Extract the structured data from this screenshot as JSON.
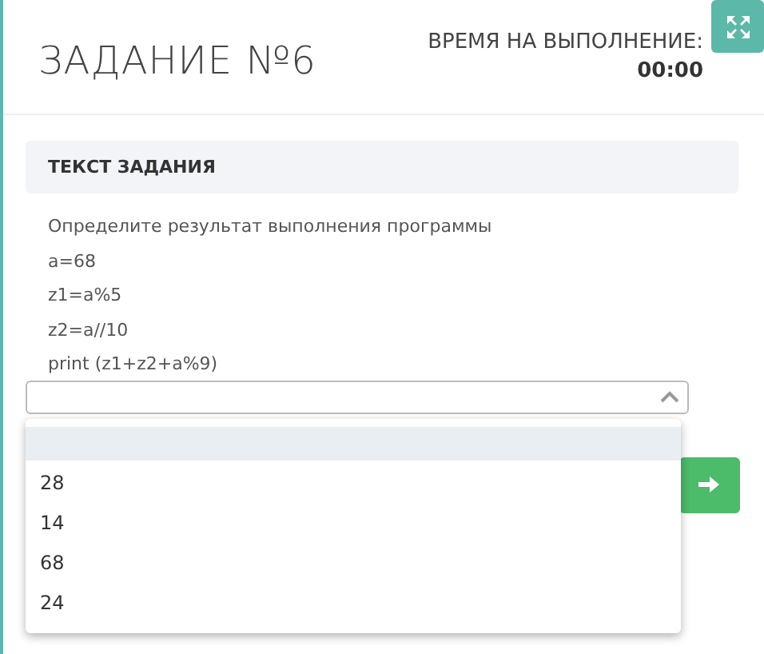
{
  "header": {
    "title": "ЗАДАНИЕ №6",
    "timer_label": "ВРЕМЯ НА ВЫПОЛНЕНИЕ:",
    "timer_value": "00:00"
  },
  "section": {
    "title": "ТЕКСТ ЗАДАНИЯ",
    "lines": [
      "Определите результат выполнения программы",
      "a=68",
      "z1=a%5",
      "z2=a//10",
      "print (z1+z2+a%9)"
    ]
  },
  "answer_select": {
    "expanded": true,
    "blank_option_highlighted": true,
    "options": [
      {
        "label": "28",
        "selected": false
      },
      {
        "label": "14",
        "selected": false
      },
      {
        "label": "68",
        "selected": false
      },
      {
        "label": "24",
        "selected": false
      }
    ]
  }
}
